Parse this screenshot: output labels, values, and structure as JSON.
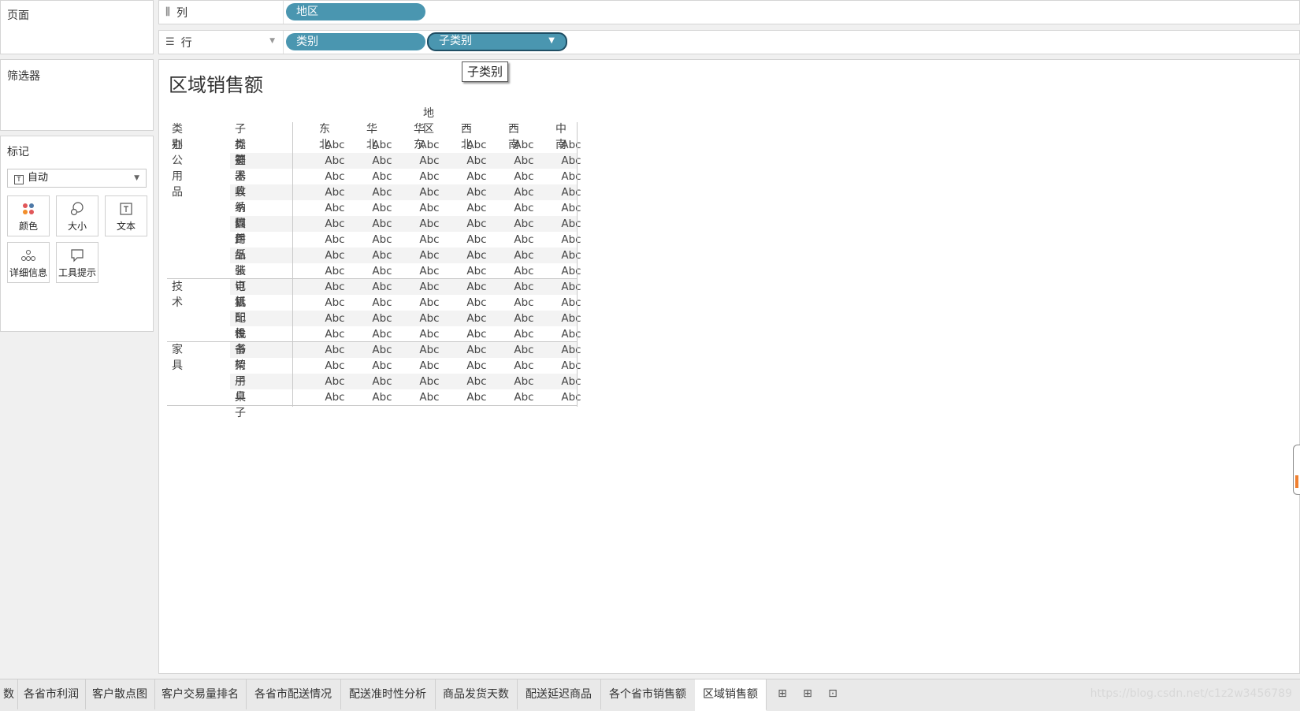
{
  "sidebar": {
    "pages_label": "页面",
    "filters_label": "筛选器",
    "marks_label": "标记",
    "mark_type": "自动",
    "mark_buttons": [
      "颜色",
      "大小",
      "文本",
      "详细信息",
      "工具提示"
    ]
  },
  "shelves": {
    "columns_label": "列",
    "rows_label": "行",
    "column_pills": [
      "地区"
    ],
    "row_pills": [
      "类别",
      "子类别"
    ]
  },
  "tooltip": "子类别",
  "view": {
    "title": "区域销售额",
    "column_header": "地区",
    "category_header": "类别",
    "subcategory_header": "子类别",
    "regions": [
      "东北",
      "华北",
      "华东",
      "西北",
      "西南",
      "中南"
    ],
    "cell_text": "Abc",
    "groups": [
      {
        "category": "办公用品",
        "subcategories": [
          "标签",
          "美术",
          "器具",
          "收纳具",
          "系固件",
          "信封",
          "用品",
          "纸张",
          "装订机"
        ]
      },
      {
        "category": "技术",
        "subcategories": [
          "电话",
          "复印机",
          "配件",
          "设备"
        ]
      },
      {
        "category": "家具",
        "subcategories": [
          "书架",
          "椅子",
          "用具",
          "桌子"
        ]
      }
    ]
  },
  "tabs": [
    "数",
    "各省市利润",
    "客户散点图",
    "客户交易量排名",
    "各省市配送情况",
    "配送准时性分析",
    "商品发货天数",
    "配送延迟商品",
    "各个省市销售额",
    "区域销售额"
  ],
  "active_tab": "区域销售额",
  "watermark": "https://blog.csdn.net/c1z2w3456789",
  "colors": {
    "pill": "#4a96b0",
    "pill_active_border": "#1f4e64",
    "accent": "#f08030"
  }
}
